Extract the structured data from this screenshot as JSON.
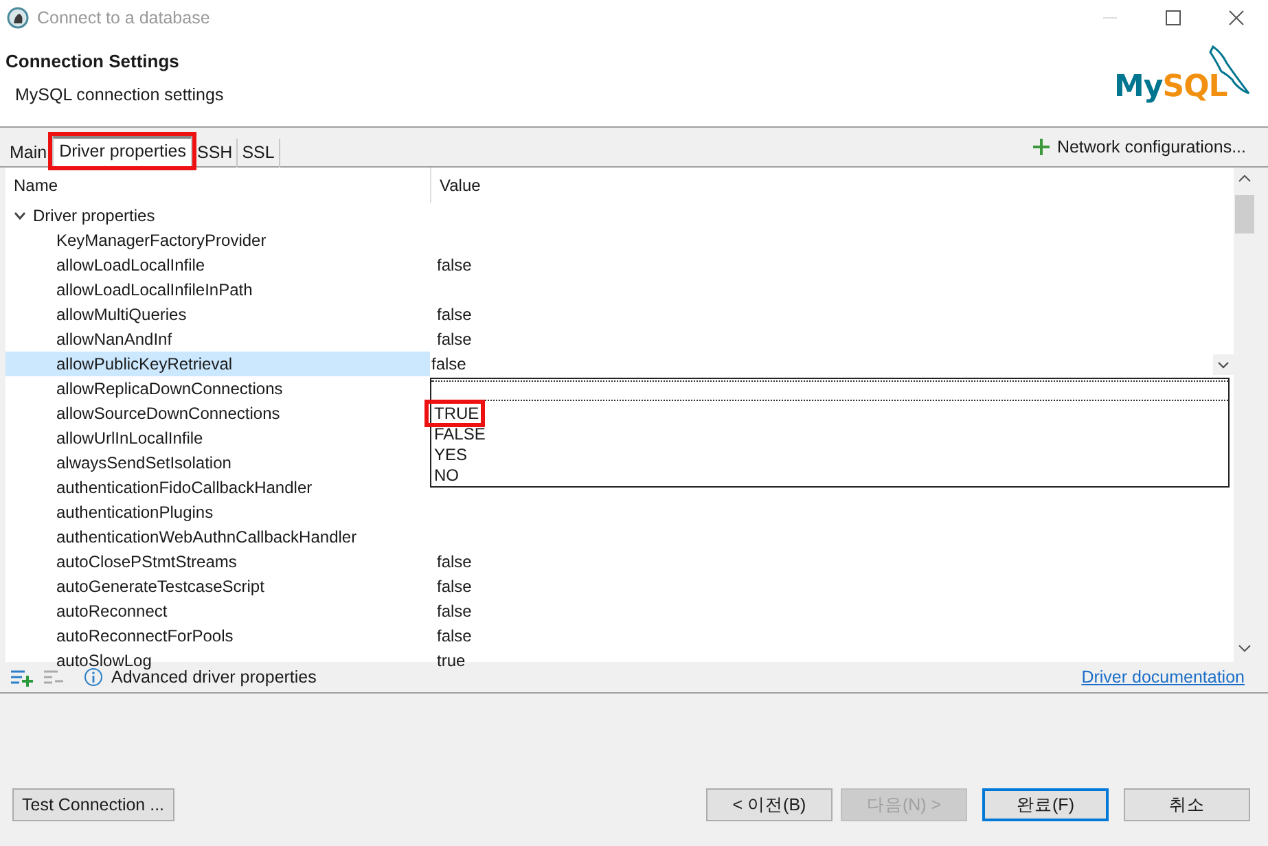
{
  "window": {
    "title": "Connect to a database"
  },
  "header": {
    "title": "Connection Settings",
    "subtitle": "MySQL connection settings",
    "logo": {
      "my": "My",
      "sql": "SQL"
    }
  },
  "tabs": [
    {
      "label": "Main",
      "selected": false,
      "highlighted": false
    },
    {
      "label": "Driver properties",
      "selected": true,
      "highlighted": true
    },
    {
      "label": "SSH",
      "selected": false,
      "highlighted": false
    },
    {
      "label": "SSL",
      "selected": false,
      "highlighted": false
    }
  ],
  "network_button": {
    "label": "Network configurations..."
  },
  "table": {
    "columns": [
      "Name",
      "Value"
    ],
    "groups": [
      {
        "label": "Driver properties",
        "expanded": true,
        "children": [
          {
            "name": "KeyManagerFactoryProvider",
            "selected": false
          },
          {
            "name": "allowLoadLocalInfile",
            "value": "false",
            "selected": false
          },
          {
            "name": "allowLoadLocalInfileInPath",
            "selected": false
          },
          {
            "name": "allowMultiQueries",
            "value": "false",
            "selected": false
          },
          {
            "name": "allowNanAndInf",
            "value": "false",
            "selected": false
          },
          {
            "name": "allowPublicKeyRetrieval",
            "value": "false",
            "selected": true,
            "editor": {
              "options": [
                {
                  "label": "TRUE",
                  "highlighted": true
                },
                {
                  "label": "FALSE",
                  "highlighted": false
                },
                {
                  "label": "YES",
                  "highlighted": false
                },
                {
                  "label": "NO",
                  "highlighted": false
                }
              ]
            }
          },
          {
            "name": "allowReplicaDownConnections",
            "selected": false
          },
          {
            "name": "allowSourceDownConnections",
            "selected": false
          },
          {
            "name": "allowUrlInLocalInfile",
            "selected": false
          },
          {
            "name": "alwaysSendSetIsolation",
            "selected": false
          },
          {
            "name": "authenticationFidoCallbackHandler",
            "selected": false
          },
          {
            "name": "authenticationPlugins",
            "selected": false
          },
          {
            "name": "authenticationWebAuthnCallbackHandler",
            "selected": false
          },
          {
            "name": "autoClosePStmtStreams",
            "value": "false",
            "selected": false
          },
          {
            "name": "autoGenerateTestcaseScript",
            "value": "false",
            "selected": false
          },
          {
            "name": "autoReconnect",
            "value": "false",
            "selected": false
          },
          {
            "name": "autoReconnectForPools",
            "value": "false",
            "selected": false
          },
          {
            "name": "autoSlowLog",
            "value": "true",
            "selected": false
          }
        ]
      }
    ]
  },
  "footer": {
    "info": "Advanced driver properties",
    "link": "Driver documentation"
  },
  "buttons": [
    {
      "label": "Test Connection ...",
      "kind": "left",
      "disabled": false,
      "default": false
    },
    {
      "label": "< 이전(B)",
      "kind": "right",
      "disabled": false,
      "default": false
    },
    {
      "label": "다음(N) >",
      "kind": "right",
      "disabled": true,
      "default": false
    },
    {
      "label": "완료(F)",
      "kind": "right",
      "disabled": false,
      "default": true
    },
    {
      "label": "취소",
      "kind": "right",
      "disabled": false,
      "default": false
    }
  ]
}
